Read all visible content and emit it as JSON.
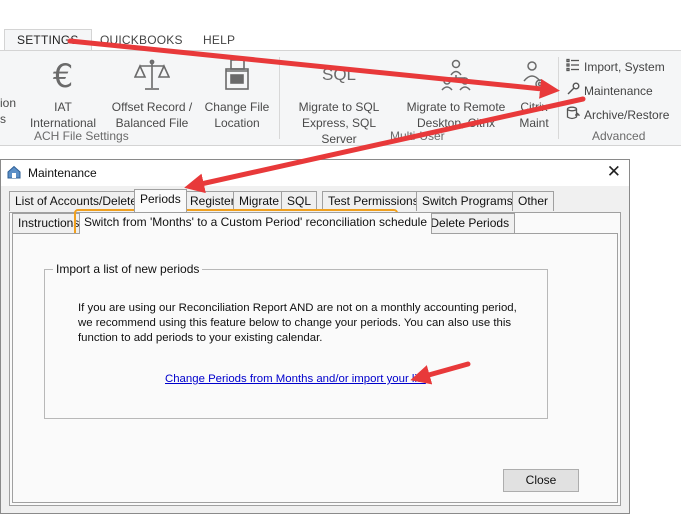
{
  "ribbon": {
    "tabs": [
      {
        "label": "SETTINGS"
      },
      {
        "label": "QUICKBOOKS"
      },
      {
        "label": "HELP"
      }
    ],
    "buttons": {
      "partial_left": {
        "line1": "ion",
        "line2": "s"
      },
      "iat": {
        "line1": "IAT",
        "line2": "International"
      },
      "offset": {
        "line1": "Offset Record /",
        "line2": "Balanced File"
      },
      "change_file": {
        "line1": "Change File",
        "line2": "Location"
      },
      "migrate_sql": {
        "line1": "Migrate to SQL",
        "line2": "Express, SQL Server",
        "icon_text": "SQL"
      },
      "migrate_remote": {
        "line1": "Migrate to Remote",
        "line2": "Desktop, Citrix"
      },
      "citrix": {
        "line1": "Citrix",
        "line2": "Maint"
      }
    },
    "groups": {
      "ach": "ACH File Settings",
      "multi_user": "Multi-User",
      "advanced": "Advanced"
    },
    "advanced_items": [
      {
        "label": "Import, System"
      },
      {
        "label": "Maintenance"
      },
      {
        "label": "Archive/Restore"
      }
    ]
  },
  "dialog": {
    "title": "Maintenance",
    "tabs": [
      {
        "label": "List of Accounts/Delete"
      },
      {
        "label": "Periods"
      },
      {
        "label": "Register"
      },
      {
        "label": "Migrate"
      },
      {
        "label": "SQL"
      },
      {
        "label": "Test Permissions"
      },
      {
        "label": "Switch Programs"
      },
      {
        "label": "Other"
      }
    ],
    "subtabs": [
      {
        "label": "Instructions"
      },
      {
        "label": "Switch from 'Months' to a Custom Period' reconciliation schedule"
      },
      {
        "label": "Add / Delete Periods"
      }
    ],
    "groupbox_title": "Import a list of new periods",
    "description": "If you are using our Reconciliation Report AND are not on a monthly accounting period, we recommend using this feature below to change your periods.  You can also use this function to add periods to your existing calendar.",
    "link": "Change Periods from Months and/or import your list",
    "close_button": "Close"
  },
  "colors": {
    "arrow": "#e8393a",
    "highlight": "#f0a01e",
    "link": "#0000cc"
  }
}
